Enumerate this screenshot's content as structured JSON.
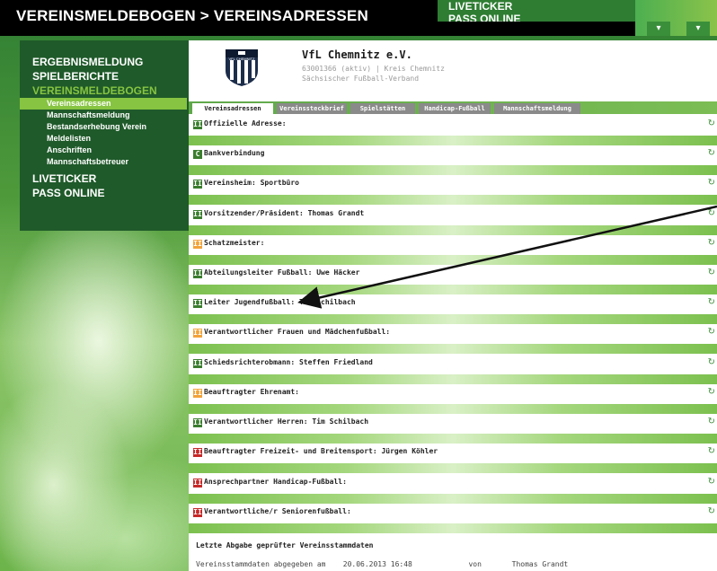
{
  "header": {
    "breadcrumb": "VEREINSMELDEBOGEN > VEREINSADRESSEN",
    "top_menu": [
      "LIVETICKER",
      "PASS ONLINE"
    ]
  },
  "sidebar": {
    "main_items": [
      {
        "label": "ERGEBNISMELDUNG",
        "active": false
      },
      {
        "label": "SPIELBERICHTE",
        "active": false
      },
      {
        "label": "VEREINSMELDEBOGEN",
        "active": true
      }
    ],
    "sub_items": [
      {
        "label": "Vereinsadressen",
        "active": true
      },
      {
        "label": "Mannschaftsmeldung",
        "active": false
      },
      {
        "label": "Bestandserhebung Verein",
        "active": false
      },
      {
        "label": "Meldelisten",
        "active": false
      },
      {
        "label": "Anschriften",
        "active": false
      },
      {
        "label": "Mannschaftsbetreuer",
        "active": false
      }
    ],
    "bottom_items": [
      "LIVETICKER",
      "PASS ONLINE"
    ]
  },
  "club": {
    "logo_text": "VFL CHEMNITZ",
    "name": "VfL Chemnitz e.V.",
    "id_line": "63001366 (aktiv) | Kreis Chemnitz",
    "association": "Sächsischer Fußball-Verband"
  },
  "tabs": [
    {
      "label": "Vereinsadressen",
      "active": true
    },
    {
      "label": "Vereinssteckbrief",
      "active": false
    },
    {
      "label": "Spielstätten",
      "active": false
    },
    {
      "label": "Handicap-Fußball",
      "active": false
    },
    {
      "label": "Mannschaftsmeldung",
      "active": false
    }
  ],
  "rows": [
    {
      "badge": "II",
      "status": "green",
      "label": "Offizielle Adresse:"
    },
    {
      "badge": "C",
      "status": "green",
      "label": "Bankverbindung"
    },
    {
      "badge": "II",
      "status": "green",
      "label": "Vereinsheim: Sportbüro"
    },
    {
      "badge": "II",
      "status": "green",
      "label": "Vorsitzender/Präsident: Thomas Grandt"
    },
    {
      "badge": "II",
      "status": "yellow",
      "label": "Schatzmeister:"
    },
    {
      "badge": "II",
      "status": "green",
      "label": "Abteilungsleiter Fußball: Uwe Häcker"
    },
    {
      "badge": "II",
      "status": "green",
      "label": "Leiter Jugendfußball: Tim Schilbach"
    },
    {
      "badge": "II",
      "status": "yellow",
      "label": "Verantwortlicher Frauen und Mädchenfußball:"
    },
    {
      "badge": "II",
      "status": "green",
      "label": "Schiedsrichterobmann: Steffen Friedland"
    },
    {
      "badge": "II",
      "status": "yellow",
      "label": "Beauftragter Ehrenamt:"
    },
    {
      "badge": "II",
      "status": "green",
      "label": "Verantwortlicher Herren: Tim Schilbach"
    },
    {
      "badge": "II",
      "status": "red",
      "label": "Beauftragter Freizeit- und Breitensport: Jürgen Köhler"
    },
    {
      "badge": "II",
      "status": "red",
      "label": "Ansprechpartner Handicap-Fußball:"
    },
    {
      "badge": "II",
      "status": "red",
      "label": "Verantwortliche/r Seniorenfußball:"
    }
  ],
  "status_colors": {
    "green": "#3a7d2e",
    "yellow": "#f2a33a",
    "red": "#c62828"
  },
  "footer": {
    "title": "Letzte Abgabe geprüfter Vereinsstammdaten",
    "submitted_label": "Vereinsstammdaten abgegeben am",
    "submitted_date": "20.06.2013 16:48",
    "by_label": "von",
    "by_name": "Thomas Grandt"
  },
  "icons": {
    "row_action": "edit-arrow-icon"
  }
}
